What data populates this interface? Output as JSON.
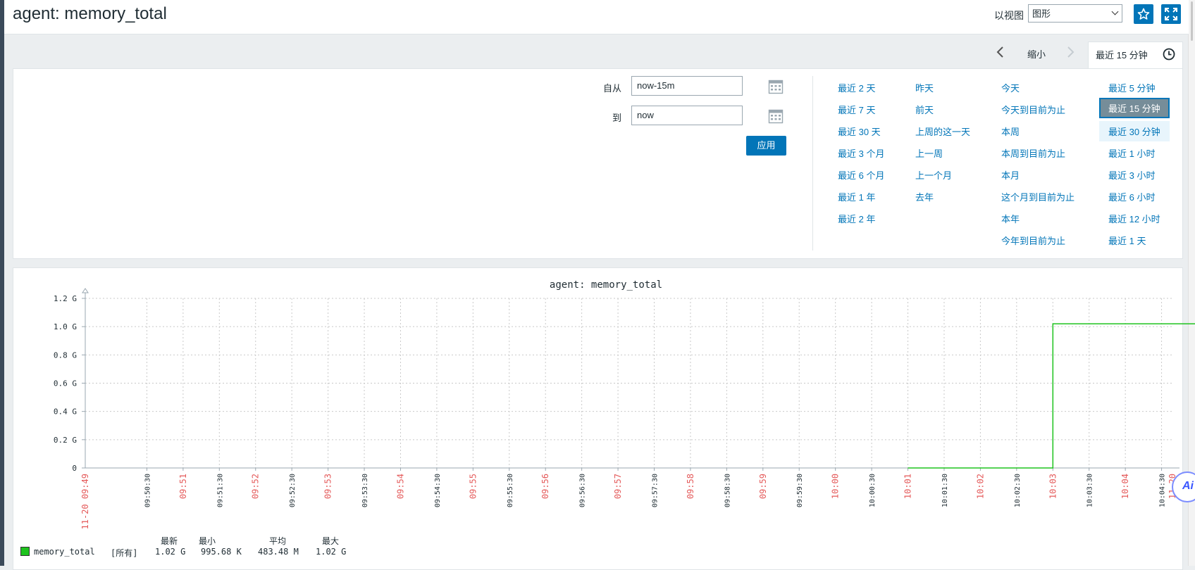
{
  "header": {
    "title": "agent: memory_total",
    "view_as_label": "以视图",
    "view_select_value": "图形"
  },
  "timebar": {
    "zoom_out_label": "缩小",
    "active_tab_label": "最近 15 分钟"
  },
  "filter": {
    "from_label": "自从",
    "from_value": "now-15m",
    "to_label": "到",
    "to_value": "now",
    "apply_label": "应用",
    "quick_ranges": [
      [
        "最近 2 天",
        "最近 7 天",
        "最近 30 天",
        "最近 3 个月",
        "最近 6 个月",
        "最近 1 年",
        "最近 2 年"
      ],
      [
        "昨天",
        "前天",
        "上周的这一天",
        "上一周",
        "上一个月",
        "去年"
      ],
      [
        "今天",
        "今天到目前为止",
        "本周",
        "本周到目前为止",
        "本月",
        "这个月到目前为止",
        "本年",
        "今年到目前为止"
      ],
      [
        "最近 5 分钟",
        "最近 15 分钟",
        "最近 30 分钟",
        "最近 1 小时",
        "最近 3 小时",
        "最近 6 小时",
        "最近 12 小时",
        "最近 1 天"
      ]
    ],
    "selected_range": "最近 15 分钟"
  },
  "chart_data": {
    "type": "line",
    "title": "agent: memory_total",
    "y_ticks": [
      "1.2 G",
      "1.0 G",
      "0.8 G",
      "0.6 G",
      "0.4 G",
      "0.2 G",
      "0"
    ],
    "ylim_gb": [
      0,
      1.2
    ],
    "x_start_label": "11-20 09:49",
    "x_end_label": "11-20",
    "x_ticks": [
      {
        "label": "09:50:30",
        "red": false
      },
      {
        "label": "09:51",
        "red": true
      },
      {
        "label": "09:51:30",
        "red": false
      },
      {
        "label": "09:52",
        "red": true
      },
      {
        "label": "09:52:30",
        "red": false
      },
      {
        "label": "09:53",
        "red": true
      },
      {
        "label": "09:53:30",
        "red": false
      },
      {
        "label": "09:54",
        "red": true
      },
      {
        "label": "09:54:30",
        "red": false
      },
      {
        "label": "09:55",
        "red": true
      },
      {
        "label": "09:55:30",
        "red": false
      },
      {
        "label": "09:56",
        "red": true
      },
      {
        "label": "09:56:30",
        "red": false
      },
      {
        "label": "09:57",
        "red": true
      },
      {
        "label": "09:57:30",
        "red": false
      },
      {
        "label": "09:58",
        "red": true
      },
      {
        "label": "09:58:30",
        "red": false
      },
      {
        "label": "09:59",
        "red": true
      },
      {
        "label": "09:59:30",
        "red": false
      },
      {
        "label": "10:00",
        "red": true
      },
      {
        "label": "10:00:30",
        "red": false
      },
      {
        "label": "10:01",
        "red": true
      },
      {
        "label": "10:01:30",
        "red": false
      },
      {
        "label": "10:02",
        "red": true
      },
      {
        "label": "10:02:30",
        "red": false
      },
      {
        "label": "10:03",
        "red": true
      },
      {
        "label": "10:03:30",
        "red": false
      },
      {
        "label": "10:04",
        "red": true
      },
      {
        "label": "10:04:30",
        "red": false
      }
    ],
    "series": [
      {
        "name": "memory_total",
        "color": "#1ec31e",
        "points": [
          {
            "x": "10:01",
            "y_gb": 0.0
          },
          {
            "x": "10:03",
            "y_gb": 0.0
          },
          {
            "x": "10:03",
            "y_gb": 1.02
          },
          {
            "x": "10:05",
            "y_gb": 1.02
          }
        ]
      }
    ],
    "legend": {
      "headers": [
        "最新",
        "最小",
        "平均",
        "最大"
      ],
      "name": "memory_total",
      "func": "[所有]",
      "last": "1.02 G",
      "min": "995.68 K",
      "avg": "483.48 M",
      "max": "1.02 G"
    }
  }
}
